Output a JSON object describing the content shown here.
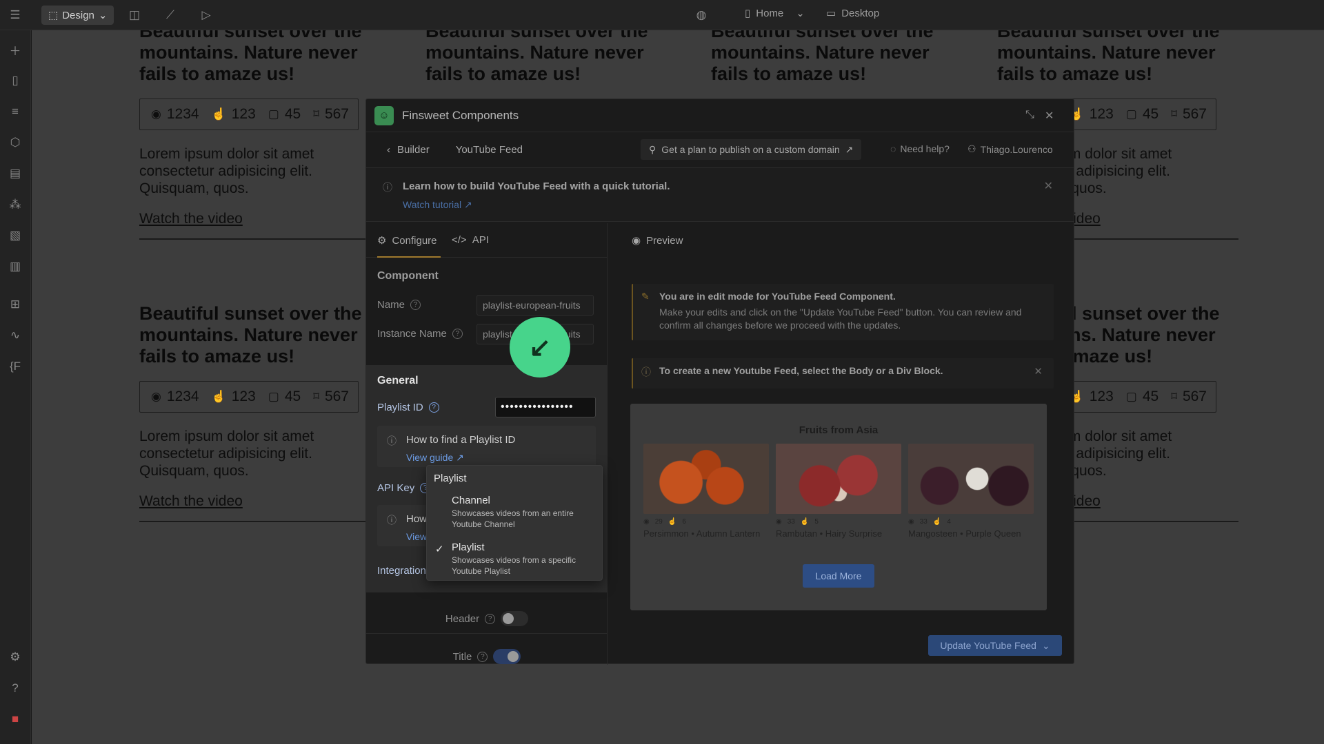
{
  "topbar": {
    "mode_label": "Design",
    "page_label": "Home",
    "device_label": "Desktop"
  },
  "cards": {
    "title": "Beautiful sunset over the mountains. Nature never fails to amaze us!",
    "views": "1234",
    "likes": "123",
    "comments": "45",
    "saves": "567",
    "body": "Lorem ipsum dolor sit amet consectetur adipisicing elit. Quisquam, quos.",
    "link": "Watch the video"
  },
  "modal": {
    "title": "Finsweet Components",
    "builder_label": "Builder",
    "crumb": "YouTube Feed",
    "plan_label": "Get a plan to publish on a custom domain",
    "help_label": "Need help?",
    "user_label": "Thiago.Lourenco",
    "tutorial_text": "Learn how to build YouTube Feed with a quick tutorial.",
    "tutorial_link": "Watch tutorial",
    "tab_configure": "Configure",
    "tab_api": "API",
    "tab_preview": "Preview",
    "component_title": "Component",
    "name_label": "Name",
    "name_value": "playlist-european-fruits",
    "instance_label": "Instance Name",
    "instance_value": "playlist-european-fruits",
    "general_title": "General",
    "playlist_id_label": "Playlist ID",
    "playlist_id_value": "••••••••••••••••",
    "find_playlist_text": "How to find a Playlist ID",
    "view_guide": "View guide",
    "api_key_label": "API Key",
    "api_info_text": "How",
    "api_info_link": "View",
    "integration_label": "Integration",
    "dropdown_header": "Playlist",
    "opt_channel_label": "Channel",
    "opt_channel_desc": "Showcases videos from an entire Youtube Channel",
    "opt_playlist_label": "Playlist",
    "opt_playlist_desc": "Showcases videos from a specific Youtube Playlist",
    "header_toggle_label": "Header",
    "title_toggle_label": "Title",
    "edit_note_title": "You are in edit mode for YouTube Feed Component.",
    "edit_note_desc": "Make your edits and click on the \"Update YouTube Feed\" button. You can review and confirm all changes before we proceed with the updates.",
    "create_note": "To create a new Youtube Feed, select the Body or a Div Block.",
    "feed_title": "Fruits from Asia",
    "videos": [
      {
        "views": "29",
        "likes": "6",
        "title": "Persimmon • Autumn Lantern"
      },
      {
        "views": "33",
        "likes": "5",
        "title": "Rambutan • Hairy Surprise"
      },
      {
        "views": "33",
        "likes": "4",
        "title": "Mangosteen • Purple Queen"
      }
    ],
    "load_more": "Load More",
    "update_label": "Update YouTube Feed"
  }
}
